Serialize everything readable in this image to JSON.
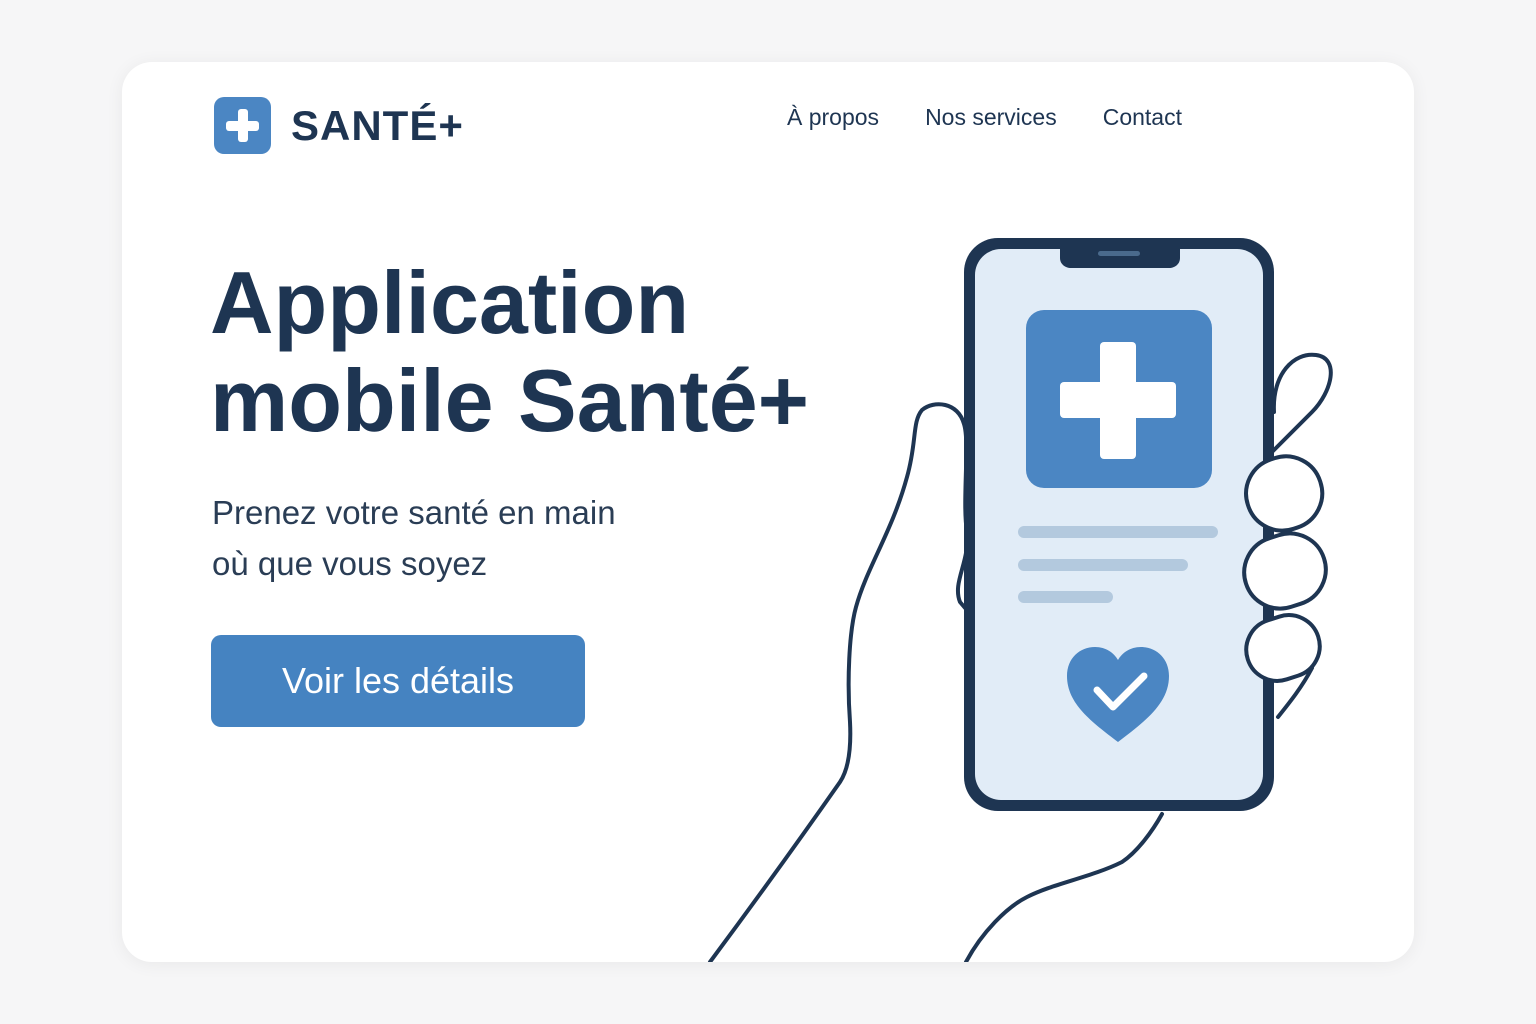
{
  "brand": {
    "name": "SANTÉ+",
    "logo_icon": "medical-cross-icon",
    "accent_color": "#4583c1",
    "text_color": "#1e3552"
  },
  "nav": {
    "items": [
      {
        "label": "À propos"
      },
      {
        "label": "Nos services"
      },
      {
        "label": "Contact"
      }
    ]
  },
  "hero": {
    "title_line1": "Application",
    "title_line2": "mobile Santé+",
    "subtitle_line1": "Prenez votre santé en main",
    "subtitle_line2": "où que vous soyez",
    "cta_label": "Voir les détails"
  },
  "illustration": {
    "subject": "hand-holding-phone",
    "app_icon": "medical-cross-icon",
    "bottom_icon": "heart-check-icon"
  }
}
